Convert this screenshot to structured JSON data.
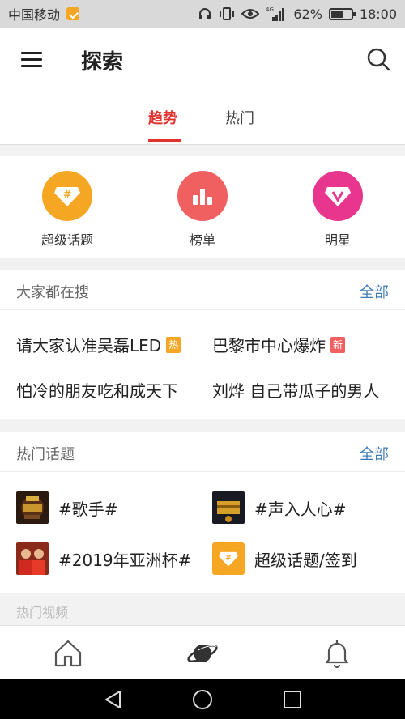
{
  "status_bar": {
    "carrier": "中国移动",
    "network": "4G",
    "battery_percent": "62%",
    "battery_level": 0.62,
    "time": "18:00"
  },
  "header": {
    "title": "探索",
    "tabs": [
      {
        "label": "趋势",
        "active": true
      },
      {
        "label": "热门",
        "active": false
      }
    ]
  },
  "quick_entries": [
    {
      "label": "超级话题",
      "icon": "diamond-hash-icon",
      "color": "#f5a623"
    },
    {
      "label": "榜单",
      "icon": "bar-chart-icon",
      "color": "#f06060"
    },
    {
      "label": "明星",
      "icon": "diamond-v-icon",
      "color": "#e8368f"
    }
  ],
  "hot_search": {
    "title": "大家都在搜",
    "more": "全部",
    "items": [
      {
        "text": "请大家认准吴磊LED",
        "tag": "热",
        "tag_color": "#f5a623"
      },
      {
        "text": "巴黎市中心爆炸",
        "tag": "新",
        "tag_color": "#f06060"
      },
      {
        "text": "怕冷的朋友吃和成天下",
        "tag": ""
      },
      {
        "text": "刘烨 自己带瓜子的男人",
        "tag": ""
      }
    ]
  },
  "hot_topics": {
    "title": "热门话题",
    "more": "全部",
    "items": [
      {
        "label": "#歌手#"
      },
      {
        "label": "#声入人心#"
      },
      {
        "label": "#2019年亚洲杯#"
      },
      {
        "label": "超级话题/签到"
      }
    ]
  },
  "hot_video": {
    "title": "热门视频"
  },
  "colors": {
    "accent": "#e0322f",
    "link": "#3e7ab8"
  }
}
